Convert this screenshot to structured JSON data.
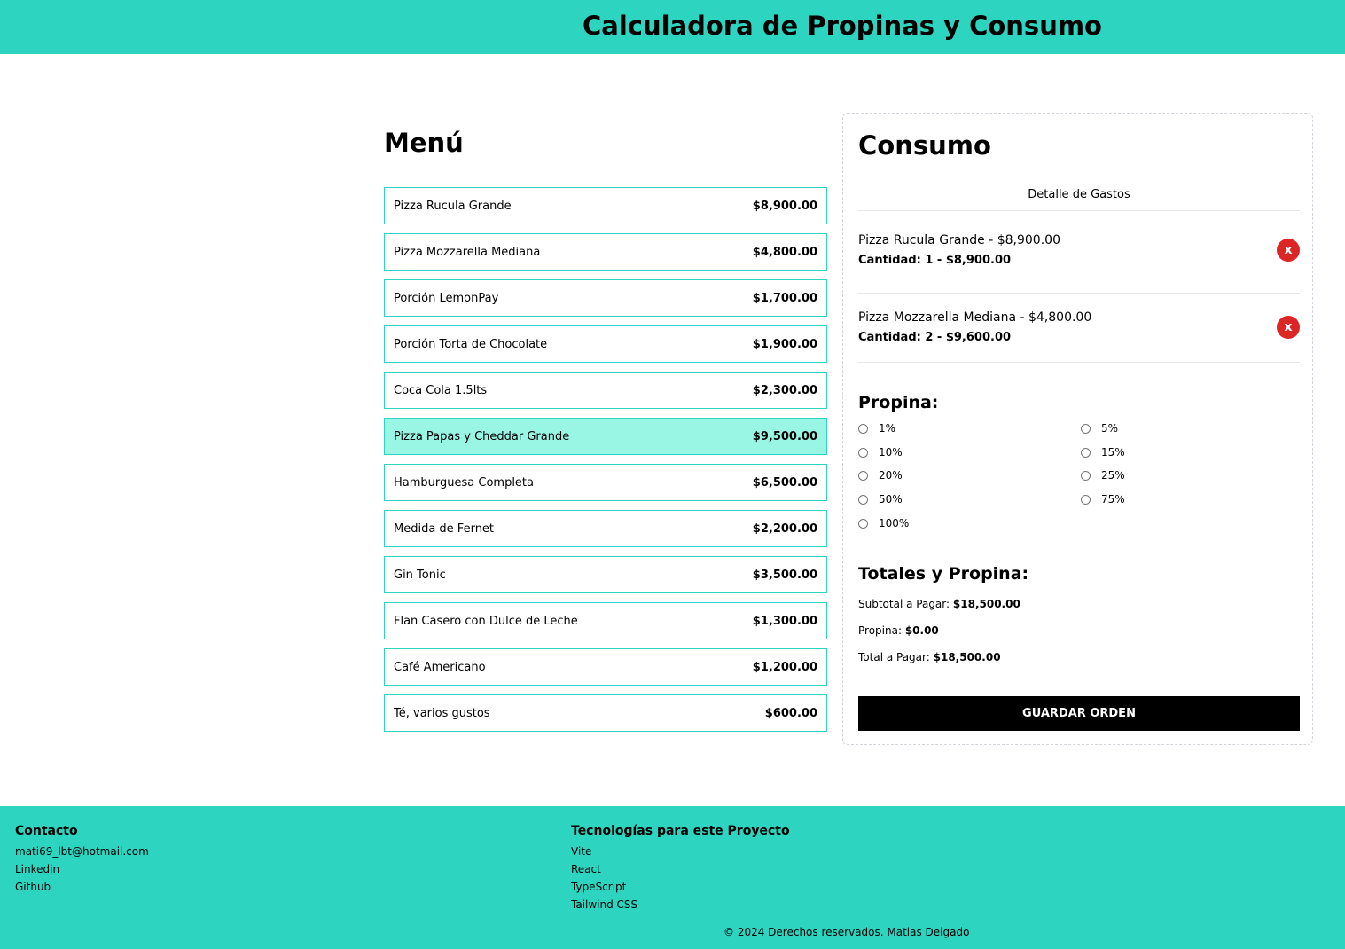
{
  "header": {
    "title": "Calculadora de Propinas y Consumo"
  },
  "menu": {
    "title": "Menú",
    "items": [
      {
        "name": "Pizza Rucula Grande",
        "price": "$8,900.00"
      },
      {
        "name": "Pizza Mozzarella Mediana",
        "price": "$4,800.00"
      },
      {
        "name": "Porción LemonPay",
        "price": "$1,700.00"
      },
      {
        "name": "Porción Torta de Chocolate",
        "price": "$1,900.00"
      },
      {
        "name": "Coca Cola 1.5lts",
        "price": "$2,300.00"
      },
      {
        "name": "Pizza Papas y Cheddar Grande",
        "price": "$9,500.00"
      },
      {
        "name": "Hamburguesa Completa",
        "price": "$6,500.00"
      },
      {
        "name": "Medida de Fernet",
        "price": "$2,200.00"
      },
      {
        "name": "Gin Tonic",
        "price": "$3,500.00"
      },
      {
        "name": "Flan Casero con Dulce de Leche",
        "price": "$1,300.00"
      },
      {
        "name": "Café Americano",
        "price": "$1,200.00"
      },
      {
        "name": "Té, varios gustos",
        "price": "$600.00"
      }
    ]
  },
  "consumo": {
    "title": "Consumo",
    "detalle": "Detalle de Gastos",
    "orders": [
      {
        "line": "Pizza Rucula Grande - $8,900.00",
        "qty": "Cantidad: 1 - $8,900.00",
        "delete": "x"
      },
      {
        "line": "Pizza Mozzarella Mediana - $4,800.00",
        "qty": "Cantidad: 2 - $9,600.00",
        "delete": "x"
      }
    ],
    "propina_title": "Propina:",
    "tips": [
      "1%",
      "5%",
      "10%",
      "15%",
      "20%",
      "25%",
      "50%",
      "75%",
      "100%"
    ],
    "totales_title": "Totales y Propina:",
    "subtotal_label": "Subtotal a Pagar:",
    "subtotal_value": "$18,500.00",
    "propina_label": "Propina:",
    "propina_value": "$0.00",
    "total_label": "Total a Pagar:",
    "total_value": "$18,500.00",
    "save_label": "GUARDAR ORDEN"
  },
  "footer": {
    "contact_title": "Contacto",
    "contact_links": [
      "mati69_lbt@hotmail.com",
      "Linkedin",
      "Github"
    ],
    "tech_title": "Tecnologías para este Proyecto",
    "tech_links": [
      "Vite",
      "React",
      "TypeScript",
      "Tailwind CSS"
    ],
    "copyright": "© 2024 Derechos reservados. Matias Delgado"
  },
  "colors": {
    "accent": "#2dd4bf",
    "hover": "#99f6e4",
    "delete": "#dc2626",
    "button": "#000000"
  }
}
